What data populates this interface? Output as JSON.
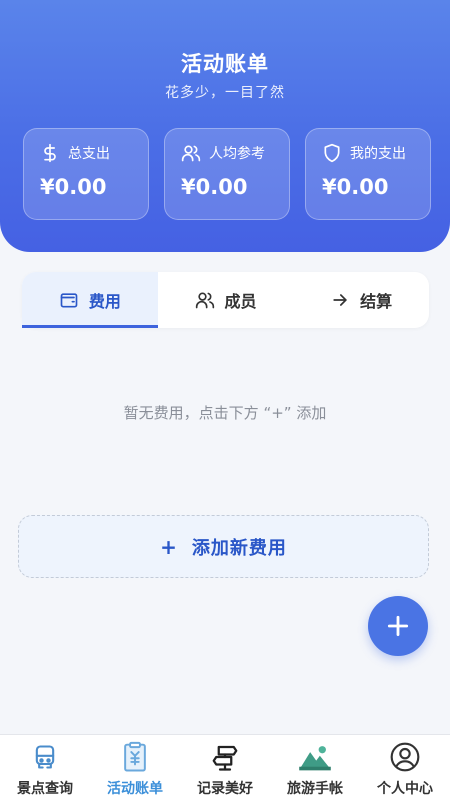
{
  "header": {
    "title": "活动账单",
    "subtitle": "花多少，一目了然"
  },
  "stats": [
    {
      "label": "总支出",
      "value": "¥0.00",
      "icon": "dollar-icon"
    },
    {
      "label": "人均参考",
      "value": "¥0.00",
      "icon": "people-icon"
    },
    {
      "label": "我的支出",
      "value": "¥0.00",
      "icon": "shield-icon"
    }
  ],
  "tabs": [
    {
      "label": "费用",
      "icon": "wallet-icon",
      "active": true
    },
    {
      "label": "成员",
      "icon": "people-icon",
      "active": false
    },
    {
      "label": "结算",
      "icon": "arrow-right-icon",
      "active": false
    }
  ],
  "empty_message": "暂无费用，点击下方 “+” 添加",
  "add_button": {
    "icon": "+",
    "label": "添加新费用"
  },
  "fab": {
    "icon": "plus-icon"
  },
  "bottom_nav": [
    {
      "label": "景点查询",
      "icon": "bus-icon",
      "active": false
    },
    {
      "label": "活动账单",
      "icon": "bill-icon",
      "active": true
    },
    {
      "label": "记录美好",
      "icon": "sign-post-icon",
      "active": false
    },
    {
      "label": "旅游手帐",
      "icon": "mountain-icon",
      "active": false
    },
    {
      "label": "个人中心",
      "icon": "user-icon",
      "active": false
    }
  ],
  "colors": {
    "primary": "#4a74e4",
    "active_tab_text": "#2a57c8",
    "active_nav": "#3b8fd9",
    "background": "#f4f6fa"
  }
}
